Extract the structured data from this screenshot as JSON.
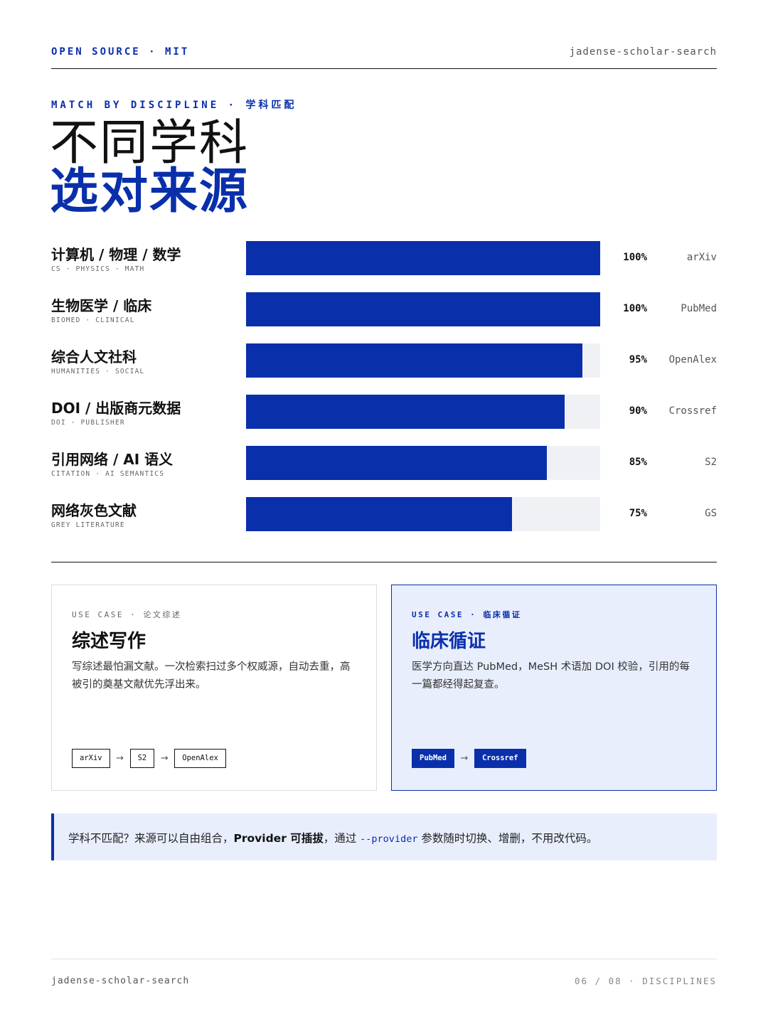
{
  "header": {
    "license": "OPEN SOURCE · MIT",
    "project": "jadense-scholar-search"
  },
  "hero": {
    "eyebrow": "MATCH BY DISCIPLINE · 学科匹配",
    "title_line1": "不同学科",
    "title_line2": "选对来源"
  },
  "colors": {
    "accent": "#0a2faa",
    "track": "#f0f1f4",
    "tint": "#e9eefd"
  },
  "chart_data": {
    "type": "bar",
    "orientation": "horizontal",
    "categories": [
      "计算机 / 物理 / 数学",
      "生物医学 / 临床",
      "综合人文社科",
      "DOI / 出版商元数据",
      "引用网络 / AI 语义",
      "网络灰色文献"
    ],
    "subtitles": [
      "CS · PHYSICS · MATH",
      "BIOMED · CLINICAL",
      "HUMANITIES · SOCIAL",
      "DOI · PUBLISHER",
      "CITATION · AI SEMANTICS",
      "GREY LITERATURE"
    ],
    "values": [
      100,
      100,
      95,
      90,
      85,
      75
    ],
    "value_labels": [
      "100%",
      "100%",
      "95%",
      "90%",
      "85%",
      "75%"
    ],
    "sources": [
      "arXiv",
      "PubMed",
      "OpenAlex",
      "Crossref",
      "S2",
      "GS"
    ],
    "xlim": [
      0,
      100
    ],
    "grid": false
  },
  "cards": [
    {
      "eyebrow": "USE CASE · 论文综述",
      "title": "综述写作",
      "body": "写综述最怕漏文献。一次检索扫过多个权威源，自动去重，高被引的奠基文献优先浮出来。",
      "chips": [
        "arXiv",
        "S2",
        "OpenAlex"
      ],
      "arrow": "→"
    },
    {
      "eyebrow": "USE CASE · 临床循证",
      "title": "临床循证",
      "body": "医学方向直达 PubMed，MeSH 术语加 DOI 校验，引用的每一篇都经得起复查。",
      "chips": [
        "PubMed",
        "Crossref"
      ],
      "arrow": "→"
    }
  ],
  "note": {
    "part1": "学科不匹配？来源可以自由组合，",
    "bold": "Provider 可插拔",
    "part2": "，通过 ",
    "code": "--provider",
    "part3": " 参数随时切换、增删，不用改代码。"
  },
  "footer": {
    "project": "jadense-scholar-search",
    "page": "06 / 08 · DISCIPLINES"
  }
}
